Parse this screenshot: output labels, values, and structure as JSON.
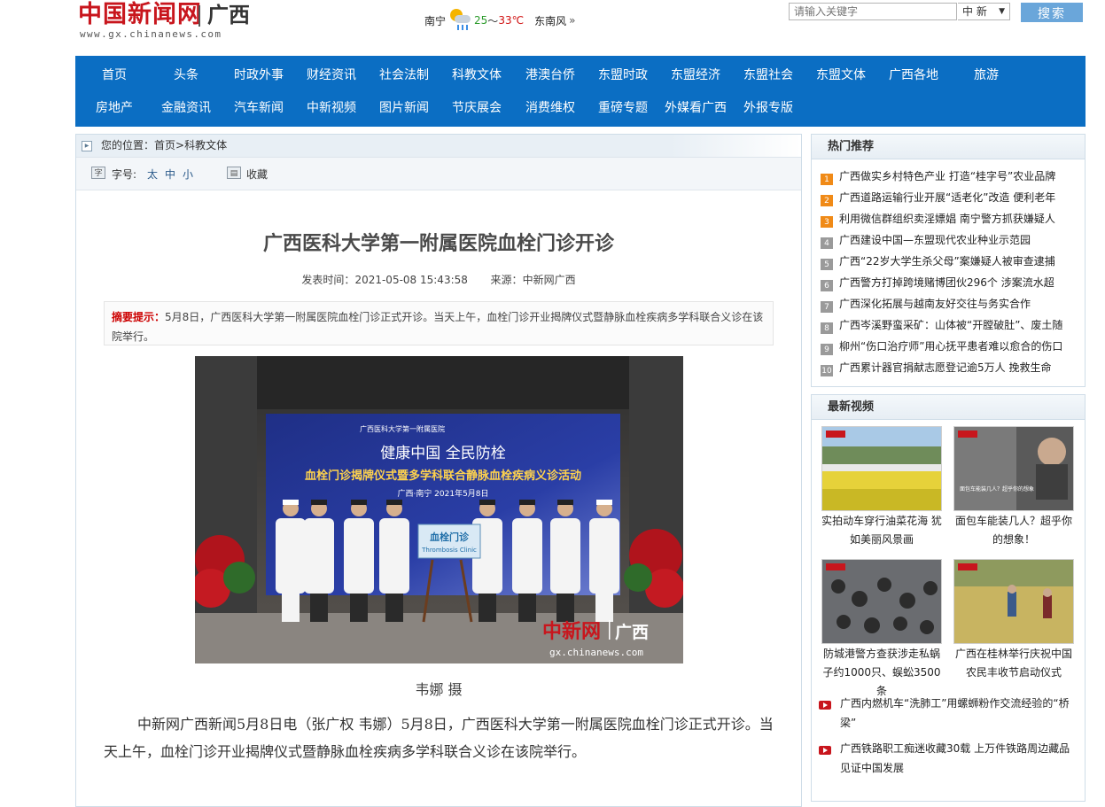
{
  "header": {
    "logo_cn": "中国新闻网",
    "logo_region": "广西",
    "logo_url": "www.gx.chinanews.com",
    "weather": {
      "city": "南宁",
      "temp_low": "25",
      "temp_sep": "～",
      "temp_high": "33℃",
      "wind": "东南风",
      "more": "»"
    },
    "search": {
      "placeholder": "请输入关键字",
      "scope": "中 新",
      "button": "搜索"
    }
  },
  "nav": {
    "row1": [
      "首页",
      "头条",
      "时政外事",
      "财经资讯",
      "社会法制",
      "科教文体",
      "港澳台侨",
      "东盟时政",
      "东盟经济",
      "东盟社会",
      "东盟文体",
      "广西各地",
      "旅游"
    ],
    "row2": [
      "房地产",
      "金融资讯",
      "汽车新闻",
      "中新视频",
      "图片新闻",
      "节庆展会",
      "消费维权",
      "重磅专题",
      "外媒看广西",
      "外报专版"
    ]
  },
  "breadcrumb": {
    "prefix": "您的位置：",
    "home": "首页",
    "sep": ">",
    "section": "科教文体"
  },
  "tools": {
    "font_label": "字号:",
    "size_large": "太",
    "size_medium": "中",
    "size_small": "小",
    "favorite": "收藏"
  },
  "article": {
    "title": "广西医科大学第一附属医院血栓门诊开诊",
    "publish_label": "发表时间：",
    "publish_time": "2021-05-08 15:43:58",
    "source_label": "来源：",
    "source": "中新网广西",
    "summary_label": "摘要提示：",
    "summary": "5月8日，广西医科大学第一附属医院血栓门诊正式开诊。当天上午，血栓门诊开业揭牌仪式暨静脉血栓疾病多学科联合义诊在该院举行。",
    "photo": {
      "banner_hospital": "广西医科大学第一附属医院",
      "banner_slogan": "健康中国  全民防栓",
      "banner_event": "血栓门诊揭牌仪式暨多学科联合静脉血栓疾病义诊活动",
      "banner_place_date": "广西·南宁   2021年5月8日",
      "plaque_cn": "血栓门诊",
      "plaque_en": "Thrombosis Clinic",
      "watermark_cn": "中新网",
      "watermark_region": "广西",
      "watermark_url": "gx.chinanews.com"
    },
    "caption": "韦娜 摄",
    "body": "中新网广西新闻5月8日电（张广权 韦娜）5月8日，广西医科大学第一附属医院血栓门诊正式开诊。当天上午，血栓门诊开业揭牌仪式暨静脉血栓疾病多学科联合义诊在该院举行。"
  },
  "hot": {
    "title": "热门推荐",
    "items": [
      "广西做实乡村特色产业 打造“桂字号”农业品牌",
      "广西道路运输行业开展“适老化”改造 便利老年",
      "利用微信群组织卖淫嫖娼 南宁警方抓获嫌疑人",
      "广西建设中国—东盟现代农业种业示范园",
      "广西“22岁大学生杀父母”案嫌疑人被审查逮捕",
      "广西警方打掉跨境赌博团伙296个 涉案流水超",
      "广西深化拓展与越南友好交往与务实合作",
      "广西岑溪野蛮采矿：山体被“开膛破肚”、废土随",
      "柳州“伤口治疗师”用心抚平患者难以愈合的伤口",
      "广西累计器官捐献志愿登记逾5万人 挽救生命"
    ]
  },
  "videos": {
    "title": "最新视频",
    "grid": [
      {
        "title": "实拍动车穿行油菜花海 犹如美丽风景画"
      },
      {
        "title": "面包车能装几人？超乎你的想象！",
        "thumb_caption": "面包车能装几人？超乎你的想象"
      },
      {
        "title": "防城港警方查获涉走私蜗子约1000只、蜈蚣3500条"
      },
      {
        "title": "广西在桂林举行庆祝中国农民丰收节启动仪式"
      }
    ],
    "list": [
      "广西内燃机车“洗肺工”用螺蛳粉作交流经验的“桥梁”",
      "广西铁路职工痴迷收藏30载 上万件铁路周边藏品见证中国发展"
    ]
  },
  "colors": {
    "nav_bg": "#0b6ec3",
    "brand_red": "#c8161d",
    "search_button": "#6aa6da"
  }
}
